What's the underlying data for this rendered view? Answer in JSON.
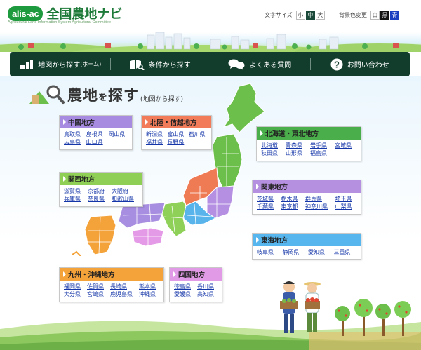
{
  "header": {
    "logo_badge": "alis-ac",
    "logo_title": "全国農地ナビ",
    "logo_subtitle": "Agricultural Land Information System Agricultural Committee",
    "font_size": {
      "label": "文字サイズ",
      "options": [
        "小",
        "中",
        "大"
      ],
      "selected": "中"
    },
    "bg_color": {
      "label": "背景色変更",
      "options": [
        "白",
        "黒",
        "青"
      ]
    }
  },
  "nav": {
    "items": [
      {
        "label": "地図から探す",
        "suffix": "(ホーム)",
        "icon": "map-home-icon"
      },
      {
        "label": "条件から探す",
        "icon": "book-search-icon"
      },
      {
        "label": "よくある質問",
        "icon": "speech-bubbles-icon"
      },
      {
        "label": "お問い合わせ",
        "icon": "question-circle-icon"
      }
    ]
  },
  "page": {
    "title_a": "農地",
    "title_wo": "を",
    "title_b": "探す",
    "subtitle": "(地図から探す)"
  },
  "regions": {
    "chugoku": {
      "title": "中国地方",
      "color": "#a78be0",
      "prefs": [
        "鳥取県",
        "島根県",
        "岡山県",
        "広島県",
        "山口県"
      ]
    },
    "hokuriku": {
      "title": "北陸・信越地方",
      "color": "#f27c5a",
      "prefs": [
        "新潟県",
        "富山県",
        "石川県",
        "福井県",
        "長野県"
      ]
    },
    "tohoku": {
      "title": "北海道・東北地方",
      "color": "#4aae4a",
      "prefs": [
        "北海道",
        "青森県",
        "岩手県",
        "宮城県",
        "秋田県",
        "山形県",
        "福島県"
      ]
    },
    "kansai": {
      "title": "関西地方",
      "color": "#8fcf55",
      "prefs": [
        "滋賀県",
        "京都府",
        "大阪府",
        "兵庫県",
        "奈良県",
        "和歌山県"
      ]
    },
    "kanto": {
      "title": "関東地方",
      "color": "#b58fe0",
      "prefs": [
        "茨城県",
        "栃木県",
        "群馬県",
        "埼玉県",
        "千葉県",
        "東京都",
        "神奈川県",
        "山梨県"
      ]
    },
    "tokai": {
      "title": "東海地方",
      "color": "#58b6ee",
      "prefs": [
        "岐阜県",
        "静岡県",
        "愛知県",
        "三重県"
      ]
    },
    "kyushu": {
      "title": "九州・沖縄地方",
      "color": "#f4a23a",
      "prefs": [
        "福岡県",
        "佐賀県",
        "長崎県",
        "熊本県",
        "大分県",
        "宮崎県",
        "鹿児島県",
        "沖縄県"
      ]
    },
    "shikoku": {
      "title": "四国地方",
      "color": "#e19ae6",
      "prefs": [
        "徳島県",
        "香川県",
        "愛媛県",
        "高知県"
      ]
    }
  }
}
